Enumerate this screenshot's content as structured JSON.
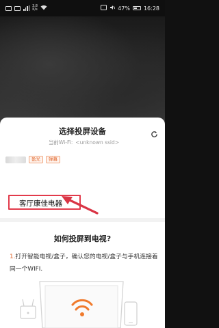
{
  "status_bar": {
    "speed_value": "3.8",
    "speed_unit": "K/s",
    "battery": "47%",
    "time": "16:28"
  },
  "sheet": {
    "title": "选择投屏设备",
    "wifi_label": "当前Wi-Fi:",
    "wifi_ssid": "<unknown ssid>",
    "tags": [
      "盈光",
      "弹幕"
    ],
    "selected_device": "客厅康佳电器",
    "howto_title": "如何投屏到电视?",
    "step_number": "1.",
    "step_text": "打开智能电视/盒子，确认您的电视/盒子与手机连接着同一个WIFI."
  },
  "colors": {
    "accent": "#e0662c",
    "highlight_border": "#e23a4b",
    "arrow": "#d93545"
  },
  "icons": [
    "refresh-icon",
    "wifi-icon",
    "tv-icon",
    "router-icon",
    "phone-icon"
  ]
}
